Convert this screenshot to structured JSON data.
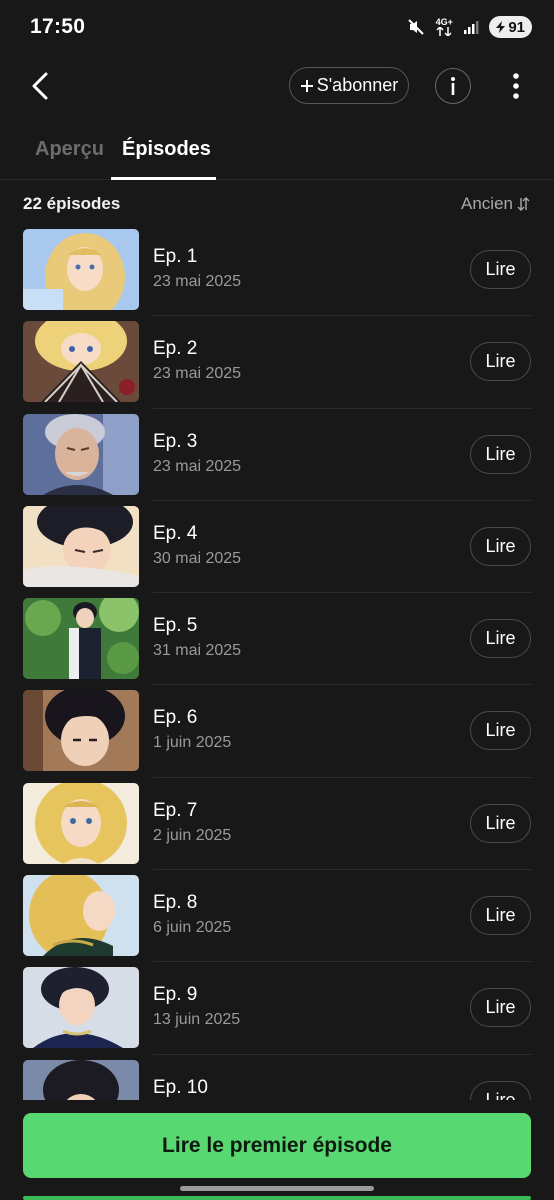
{
  "status": {
    "time": "17:50",
    "network": "4G+",
    "battery": "91"
  },
  "topbar": {
    "subscribe_label": "S'abonner",
    "info_label": "i"
  },
  "tabs": [
    {
      "label": "Aperçu",
      "active": false
    },
    {
      "label": "Épisodes",
      "active": true
    }
  ],
  "list_header": {
    "count": "22 épisodes",
    "sort_label": "Ancien"
  },
  "episodes": [
    {
      "title": "Ep. 1",
      "date": "23 mai 2025",
      "action": "Lire",
      "thumb": "blonde-girl-blue"
    },
    {
      "title": "Ep. 2",
      "date": "23 mai 2025",
      "action": "Lire",
      "thumb": "blonde-girl-fan"
    },
    {
      "title": "Ep. 3",
      "date": "23 mai 2025",
      "action": "Lire",
      "thumb": "old-man"
    },
    {
      "title": "Ep. 4",
      "date": "30 mai 2025",
      "action": "Lire",
      "thumb": "dark-hair-man"
    },
    {
      "title": "Ep. 5",
      "date": "31 mai 2025",
      "action": "Lire",
      "thumb": "garden-man"
    },
    {
      "title": "Ep. 6",
      "date": "1 juin 2025",
      "action": "Lire",
      "thumb": "dark-hair-man-2"
    },
    {
      "title": "Ep. 7",
      "date": "2 juin 2025",
      "action": "Lire",
      "thumb": "blonde-girl"
    },
    {
      "title": "Ep. 8",
      "date": "6 juin 2025",
      "action": "Lire",
      "thumb": "blonde-girl-profile"
    },
    {
      "title": "Ep. 9",
      "date": "13 juin 2025",
      "action": "Lire",
      "thumb": "dark-hair-man-3"
    },
    {
      "title": "Ep. 10",
      "date": "",
      "action": "Lire",
      "thumb": "dark-hair-man-4"
    }
  ],
  "cta": {
    "label": "Lire le premier épisode"
  },
  "colors": {
    "background": "#181818",
    "accent": "#58d870"
  }
}
